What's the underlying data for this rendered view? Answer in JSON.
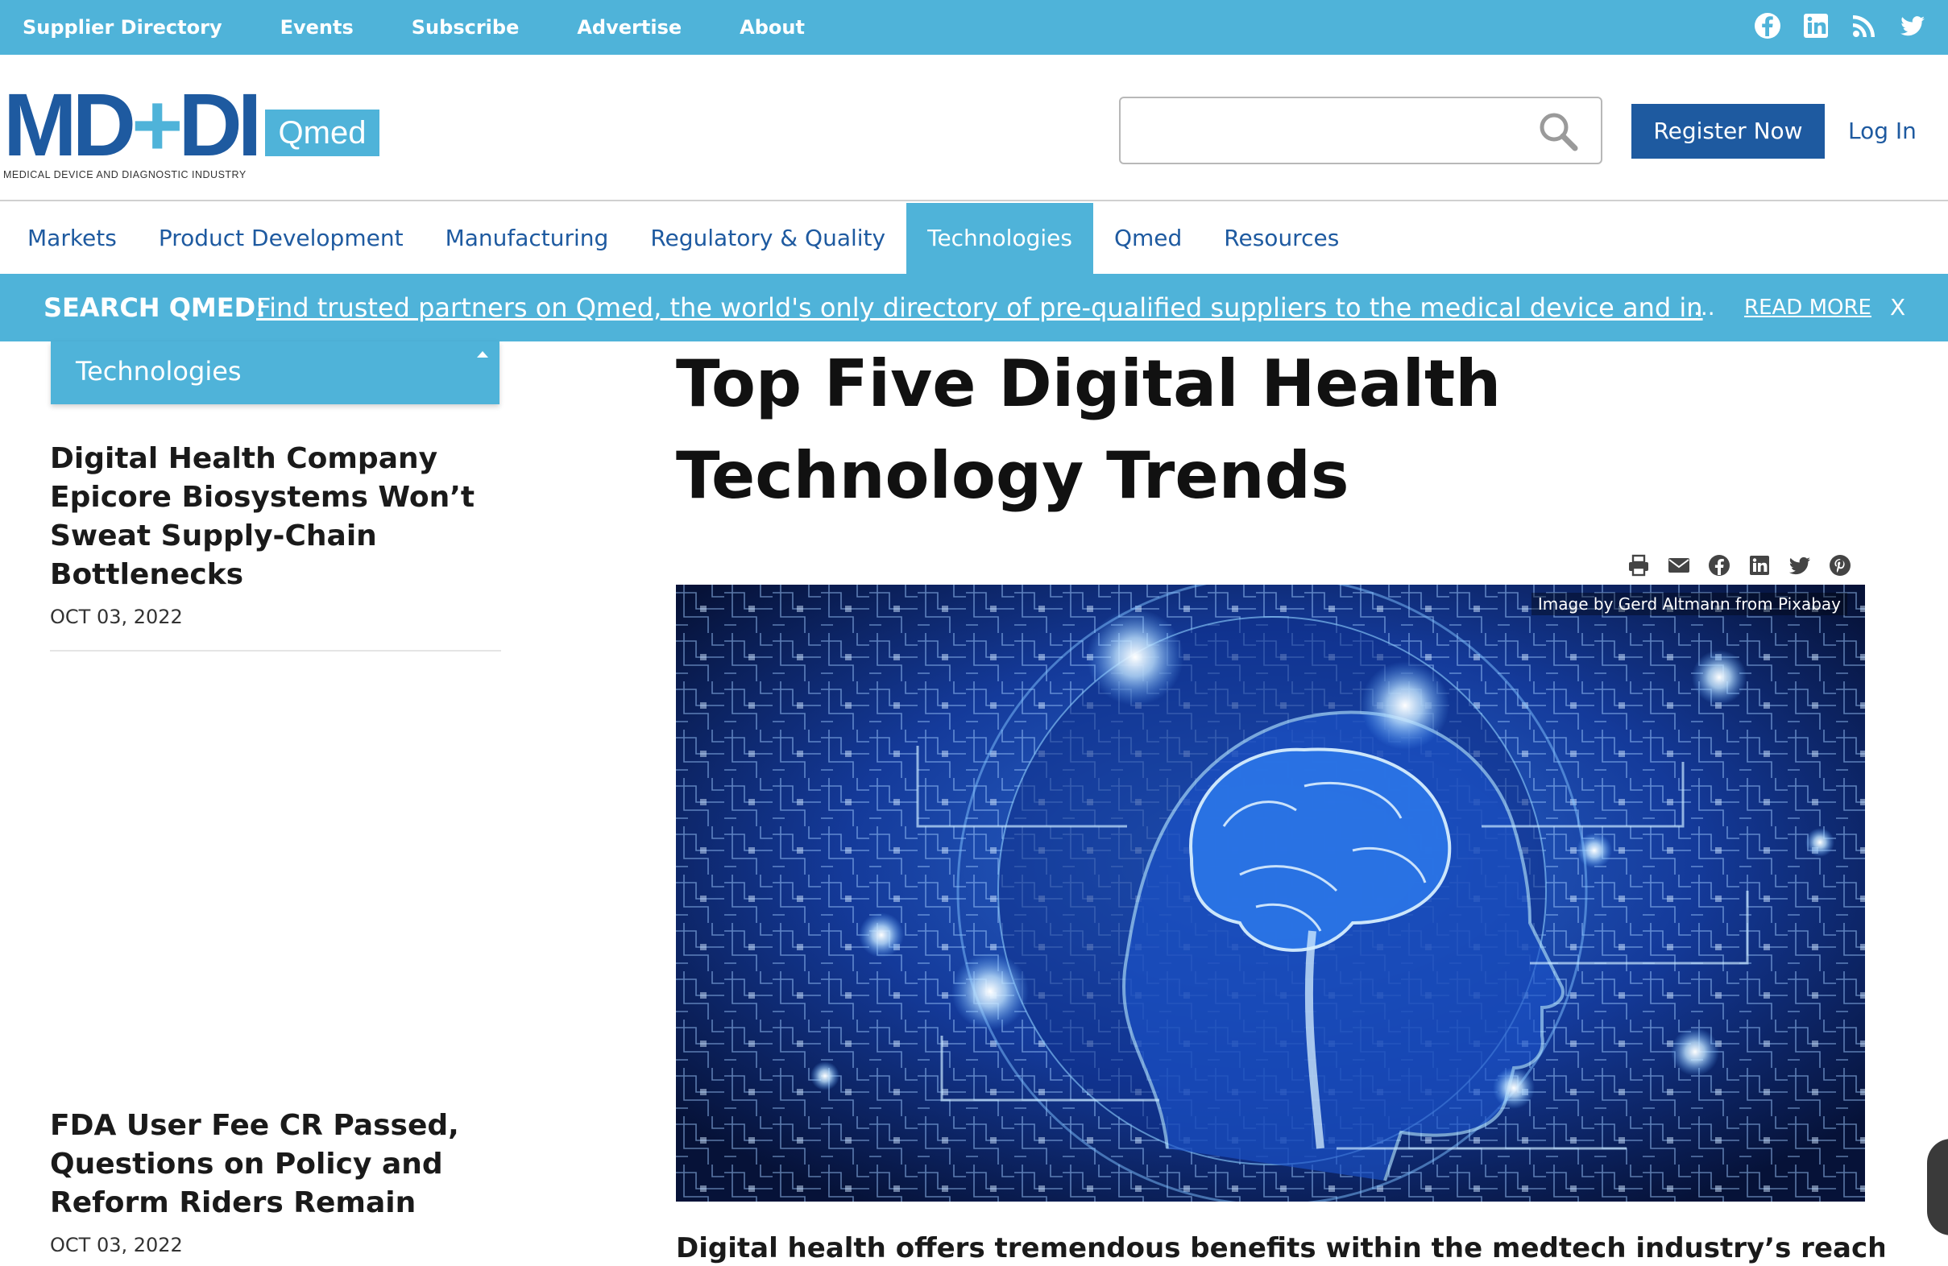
{
  "utility_nav": {
    "links": [
      "Supplier Directory",
      "Events",
      "Subscribe",
      "Advertise",
      "About"
    ],
    "social_icons": [
      "facebook-icon",
      "linkedin-icon",
      "rss-icon",
      "twitter-icon"
    ]
  },
  "header": {
    "logo": {
      "wordmark": "MD+DI",
      "badge": "Qmed",
      "tagline": "MEDICAL DEVICE AND DIAGNOSTIC INDUSTRY"
    },
    "search": {
      "value": "",
      "placeholder": ""
    },
    "register_label": "Register Now",
    "login_label": "Log In"
  },
  "main_nav": {
    "items": [
      "Markets",
      "Product Development",
      "Manufacturing",
      "Regulatory & Quality",
      "Technologies",
      "Qmed",
      "Resources"
    ],
    "active": "Technologies"
  },
  "alert": {
    "label": "SEARCH QMED:",
    "text": "Find trusted partners on Qmed, the world's only directory of pre-qualified suppliers to the medical device and in",
    "ellipsis": "...",
    "read_more": "READ MORE",
    "close": "X"
  },
  "sidebar": {
    "section": "Technologies",
    "articles": [
      {
        "title": "Digital Health Company Epicore Biosystems Won’t Sweat Supply-Chain Bottlenecks",
        "date": "OCT 03, 2022"
      },
      {
        "title": "FDA User Fee CR Passed, Questions on Policy and Reform Riders Remain",
        "date": "OCT 03, 2022"
      }
    ]
  },
  "article": {
    "title": "Top Five Digital Health Technology Trends",
    "share_icons": [
      "print-icon",
      "email-icon",
      "facebook-icon",
      "linkedin-icon",
      "twitter-icon",
      "pinterest-icon"
    ],
    "image_credit": "Image by Gerd Altmann from Pixabay",
    "lead": "Digital health offers tremendous benefits within the medtech industry’s reach. To"
  },
  "colors": {
    "accent": "#4fb3d9",
    "brand": "#1e5aa0",
    "text": "#1a1a1a"
  }
}
